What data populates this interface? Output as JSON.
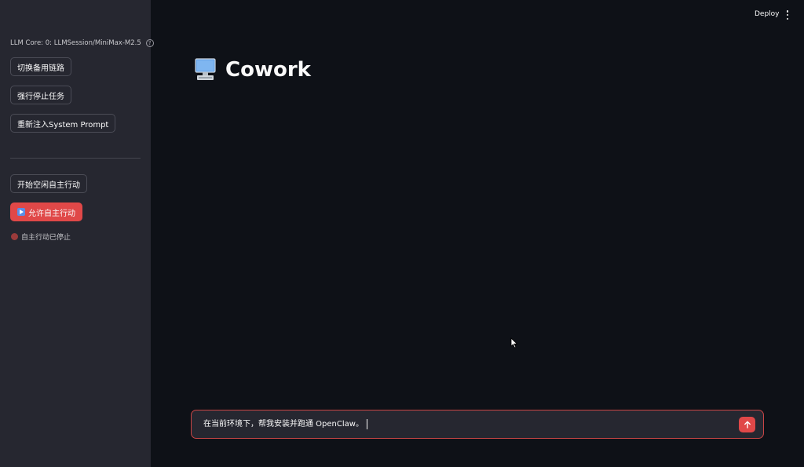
{
  "header": {
    "deploy_label": "Deploy"
  },
  "sidebar": {
    "core_label": "LLM Core: 0: LLMSession/MiniMax-M2.5",
    "help_icon": "?",
    "buttons": [
      {
        "label": "切换备用链路"
      },
      {
        "label": "强行停止任务"
      },
      {
        "label": "重新注入System Prompt"
      },
      {
        "label": "开始空闲自主行动"
      },
      {
        "label": "允许自主行动"
      }
    ],
    "status_text": "自主行动已停止"
  },
  "main": {
    "title": "Cowork",
    "title_icon": "desktop-computer-icon"
  },
  "chat": {
    "input_value": "在当前环境下，帮我安装并跑通 OpenClaw。"
  },
  "colors": {
    "accent": "#e04848",
    "sidebar_bg": "#262730",
    "main_bg": "#0e1117"
  }
}
